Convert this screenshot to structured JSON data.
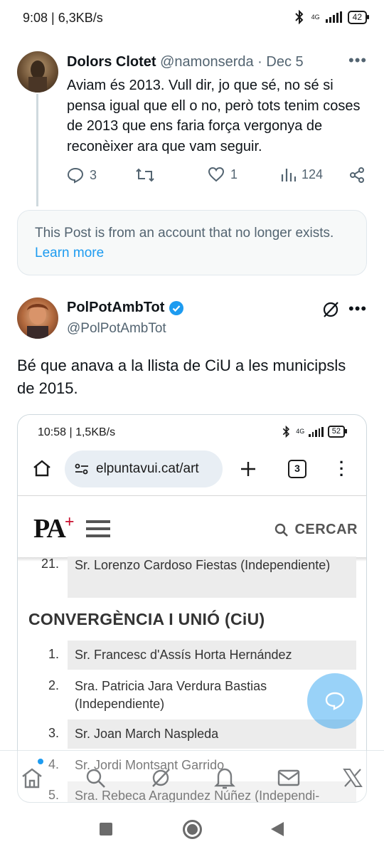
{
  "status_bar": {
    "time_speed": "9:08 | 6,3KB/s",
    "network": "4G",
    "battery": "42"
  },
  "tweet1": {
    "name": "Dolors Clotet",
    "handle": "@namonserda",
    "separator": "·",
    "date": "Dec 5",
    "text": "Aviam és 2013. Vull dir, jo que sé, no sé si pensa igual que ell o no, però tots tenim coses de 2013 que ens faria força vergonya de reconèixer ara que vam seguir.",
    "replies": "3",
    "likes": "1",
    "views": "124"
  },
  "notice": {
    "text": "This Post is from an account that no longer exists.",
    "link": "Learn more"
  },
  "tweet2": {
    "name": "PolPotAmbTot",
    "handle": "@PolPotAmbTot",
    "text": "Bé que anava a la llista de CiU a les municipsls de 2015."
  },
  "media": {
    "status_time_speed": "10:58 | 1,5KB/s",
    "network": "4G",
    "battery": "52",
    "url": "elpuntavui.cat/art",
    "tab_count": "3",
    "logo": "PA",
    "logo_plus": "+",
    "search_label": "CERCAR",
    "section_title": "CONVERGÈNCIA I UNIÓ (CiU)",
    "prev_item": {
      "num": "21.",
      "text": "Sr. Lorenzo Cardoso Fiestas (Independiente)"
    },
    "items": [
      {
        "num": "1.",
        "text": "Sr. Francesc d'Assís Horta Hernández"
      },
      {
        "num": "2.",
        "text": "Sra. Patricia Jara Verdura Bastias (Independiente)"
      },
      {
        "num": "3.",
        "text": "Sr. Joan March Naspleda"
      },
      {
        "num": "4.",
        "text": "Sr. Jordi Montsant Garrido"
      },
      {
        "num": "5.",
        "text": "Sra. Rebeca Aragundez Núñez (Independi-"
      }
    ]
  },
  "colors": {
    "accent": "#1d9bf0",
    "text": "#0f1419",
    "muted": "#536471",
    "logo_red": "#c8102e"
  },
  "icons": [
    "reply-icon",
    "retweet-icon",
    "like-icon",
    "views-icon",
    "share-icon",
    "verified-badge-icon",
    "grok-icon",
    "more-icon",
    "home-icon",
    "search-icon",
    "notifications-icon",
    "messages-icon",
    "x-logo-icon",
    "compose-icon"
  ]
}
